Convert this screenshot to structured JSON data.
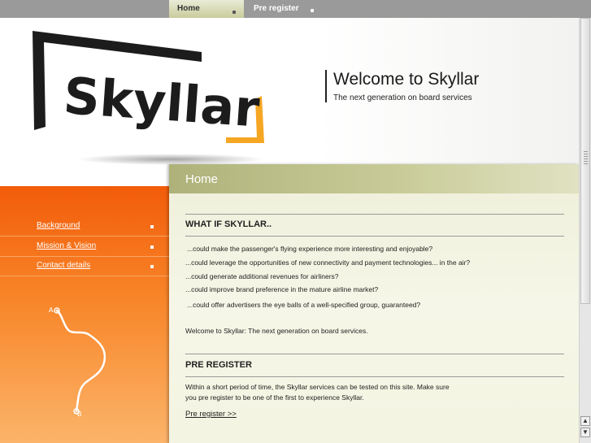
{
  "nav": {
    "tabs": [
      {
        "label": "Home",
        "active": true
      },
      {
        "label": "Pre register",
        "active": false
      }
    ]
  },
  "header": {
    "logo_text": "Skyllar",
    "welcome_title": "Welcome to Skyllar",
    "welcome_subtitle": "The next generation on board services"
  },
  "sidebar": {
    "items": [
      {
        "label": "Background"
      },
      {
        "label": "Mission & Vision"
      },
      {
        "label": "Contact details"
      }
    ],
    "route": {
      "start_label": "A",
      "end_label": "B"
    }
  },
  "main": {
    "title": "Home",
    "section1": {
      "heading": "WHAT IF SKYLLAR..",
      "questions": [
        "...could make the passenger's flying experience more interesting and enjoyable?",
        "...could leverage the opportunities of new connectivity and payment technologies... in the air?",
        "...could generate additional revenues for airliners?",
        "...could improve brand preference in the mature airline market?",
        "...could offer advertisers the eye balls of a well-specified group, guaranteed?"
      ],
      "closing": "Welcome to Skyllar: The next generation on board services."
    },
    "section2": {
      "heading": "PRE REGISTER",
      "text": "Within a short period of time, the Skyllar services can be tested on this site. Make sure you pre register to be one of the first to experience Skyllar.",
      "link": "Pre register >>"
    }
  },
  "colors": {
    "accent_orange": "#f25c0a",
    "panel_olive": "#aeb27a",
    "logo_yellow": "#f5a623"
  }
}
